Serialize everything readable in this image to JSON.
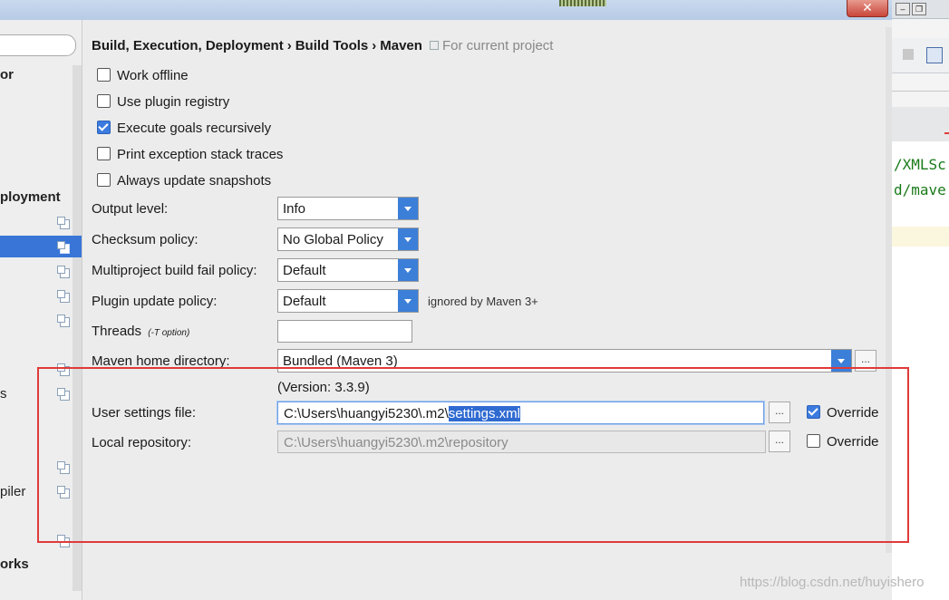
{
  "window": {
    "close_glyph": "✕"
  },
  "tree": {
    "items": [
      {
        "label": "or",
        "bold": true
      },
      {
        "label": "ployment",
        "bold": true
      },
      {
        "label": "s",
        "bold": false
      },
      {
        "label": "piler",
        "bold": false
      },
      {
        "label": "orks",
        "bold": true
      }
    ]
  },
  "breadcrumb": {
    "part1": "Build, Execution, Deployment",
    "part2": "Build Tools",
    "part3": "Maven",
    "separator": "›",
    "scope": "For current project"
  },
  "checkboxes": [
    {
      "label": "Work offline",
      "checked": false
    },
    {
      "label": "Use plugin registry",
      "checked": false
    },
    {
      "label": "Execute goals recursively",
      "checked": true
    },
    {
      "label": "Print exception stack traces",
      "checked": false
    },
    {
      "label": "Always update snapshots",
      "checked": false
    }
  ],
  "fields": {
    "output_level": {
      "label": "Output level:",
      "value": "Info"
    },
    "checksum_policy": {
      "label": "Checksum policy:",
      "value": "No Global Policy"
    },
    "multiproject_fail": {
      "label": "Multiproject build fail policy:",
      "value": "Default"
    },
    "plugin_update": {
      "label": "Plugin update policy:",
      "value": "Default",
      "note": "ignored by Maven 3+"
    },
    "threads": {
      "label": "Threads",
      "hint": "(-T option)",
      "value": ""
    },
    "maven_home": {
      "label": "Maven home directory:",
      "value": "Bundled (Maven 3)",
      "version": "(Version: 3.3.9)"
    },
    "user_settings": {
      "label": "User settings file:",
      "value_prefix": "C:\\Users\\huangyi5230\\.m2\\",
      "value_selected": "settings.xml",
      "override_label": "Override",
      "override_checked": true
    },
    "local_repo": {
      "label": "Local repository:",
      "value": "C:\\Users\\huangyi5230\\.m2\\repository",
      "override_label": "Override",
      "override_checked": false
    }
  },
  "browse_glyph": "...",
  "background_editor": {
    "lines": [
      "/XMLSc",
      "d/mave"
    ]
  },
  "watermark": "https://blog.csdn.net/huyishero",
  "colors": {
    "accent": "#3875d7",
    "highlight_box": "#e03a3a"
  }
}
